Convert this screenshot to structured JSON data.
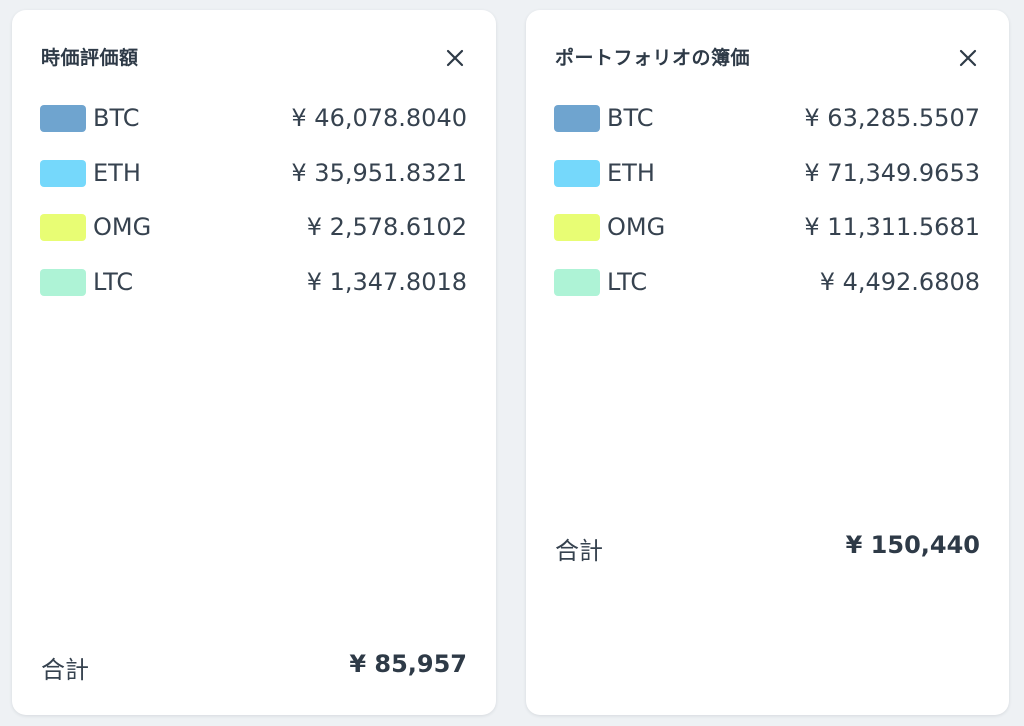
{
  "market_value": {
    "title": "時価評価額",
    "rows": [
      {
        "coin": "BTC",
        "amount": "¥ 46,078.8040",
        "color": "#6fa4cf"
      },
      {
        "coin": "ETH",
        "amount": "¥ 35,951.8321",
        "color": "#75d8fb"
      },
      {
        "coin": "OMG",
        "amount": "¥ 2,578.6102",
        "color": "#e8fd74"
      },
      {
        "coin": "LTC",
        "amount": "¥ 1,347.8018",
        "color": "#aef3d6"
      }
    ],
    "total_label": "合計",
    "total_value": "¥ 85,957"
  },
  "book_value": {
    "title": "ポートフォリオの簿価",
    "rows": [
      {
        "coin": "BTC",
        "amount": "¥ 63,285.5507",
        "color": "#6fa4cf"
      },
      {
        "coin": "ETH",
        "amount": "¥ 71,349.9653",
        "color": "#75d8fb"
      },
      {
        "coin": "OMG",
        "amount": "¥ 11,311.5681",
        "color": "#e8fd74"
      },
      {
        "coin": "LTC",
        "amount": "¥ 4,492.6808",
        "color": "#aef3d6"
      }
    ],
    "total_label": "合計",
    "total_value": "¥ 150,440"
  },
  "icons": {
    "close": "close-icon"
  }
}
